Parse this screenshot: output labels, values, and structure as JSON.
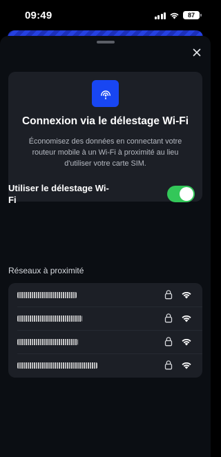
{
  "status_bar": {
    "time": "09:49",
    "battery": "87"
  },
  "sheet": {
    "card": {
      "title": "Connexion via le délestage Wi-Fi",
      "description": "Économisez des données en connectant votre routeur mobile à un Wi-Fi à proximité au lieu d'utiliser votre carte SIM.",
      "toggle_label": "Utiliser le délestage Wi-Fi",
      "toggle_on": true
    },
    "nearby": {
      "title": "Réseaux à proximité",
      "networks": [
        {
          "ssid": "[obscured]",
          "secured": true
        },
        {
          "ssid": "[obscured]",
          "secured": true
        },
        {
          "ssid": "[obscured]",
          "secured": true
        },
        {
          "ssid": "[obscured]",
          "secured": true
        }
      ]
    }
  },
  "colors": {
    "sheet_bg": "#0b0e13",
    "card_bg": "#1c1f26",
    "accent_blue": "#1846f2",
    "toggle_green": "#33c759"
  },
  "icons": {
    "feature": "wifi-offload-icon",
    "close": "close-icon",
    "lock": "lock-icon",
    "wifi": "wifi-icon"
  }
}
